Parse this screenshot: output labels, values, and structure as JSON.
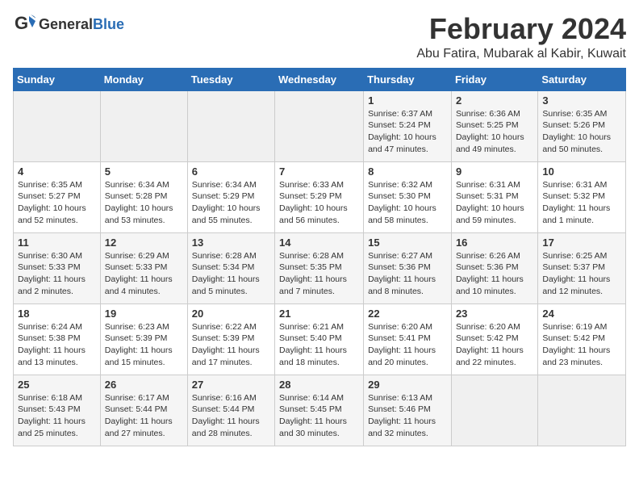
{
  "header": {
    "logo_general": "General",
    "logo_blue": "Blue",
    "month_title": "February 2024",
    "location": "Abu Fatira, Mubarak al Kabir, Kuwait"
  },
  "weekdays": [
    "Sunday",
    "Monday",
    "Tuesday",
    "Wednesday",
    "Thursday",
    "Friday",
    "Saturday"
  ],
  "weeks": [
    [
      {
        "day": "",
        "info": ""
      },
      {
        "day": "",
        "info": ""
      },
      {
        "day": "",
        "info": ""
      },
      {
        "day": "",
        "info": ""
      },
      {
        "day": "1",
        "info": "Sunrise: 6:37 AM\nSunset: 5:24 PM\nDaylight: 10 hours\nand 47 minutes."
      },
      {
        "day": "2",
        "info": "Sunrise: 6:36 AM\nSunset: 5:25 PM\nDaylight: 10 hours\nand 49 minutes."
      },
      {
        "day": "3",
        "info": "Sunrise: 6:35 AM\nSunset: 5:26 PM\nDaylight: 10 hours\nand 50 minutes."
      }
    ],
    [
      {
        "day": "4",
        "info": "Sunrise: 6:35 AM\nSunset: 5:27 PM\nDaylight: 10 hours\nand 52 minutes."
      },
      {
        "day": "5",
        "info": "Sunrise: 6:34 AM\nSunset: 5:28 PM\nDaylight: 10 hours\nand 53 minutes."
      },
      {
        "day": "6",
        "info": "Sunrise: 6:34 AM\nSunset: 5:29 PM\nDaylight: 10 hours\nand 55 minutes."
      },
      {
        "day": "7",
        "info": "Sunrise: 6:33 AM\nSunset: 5:29 PM\nDaylight: 10 hours\nand 56 minutes."
      },
      {
        "day": "8",
        "info": "Sunrise: 6:32 AM\nSunset: 5:30 PM\nDaylight: 10 hours\nand 58 minutes."
      },
      {
        "day": "9",
        "info": "Sunrise: 6:31 AM\nSunset: 5:31 PM\nDaylight: 10 hours\nand 59 minutes."
      },
      {
        "day": "10",
        "info": "Sunrise: 6:31 AM\nSunset: 5:32 PM\nDaylight: 11 hours\nand 1 minute."
      }
    ],
    [
      {
        "day": "11",
        "info": "Sunrise: 6:30 AM\nSunset: 5:33 PM\nDaylight: 11 hours\nand 2 minutes."
      },
      {
        "day": "12",
        "info": "Sunrise: 6:29 AM\nSunset: 5:33 PM\nDaylight: 11 hours\nand 4 minutes."
      },
      {
        "day": "13",
        "info": "Sunrise: 6:28 AM\nSunset: 5:34 PM\nDaylight: 11 hours\nand 5 minutes."
      },
      {
        "day": "14",
        "info": "Sunrise: 6:28 AM\nSunset: 5:35 PM\nDaylight: 11 hours\nand 7 minutes."
      },
      {
        "day": "15",
        "info": "Sunrise: 6:27 AM\nSunset: 5:36 PM\nDaylight: 11 hours\nand 8 minutes."
      },
      {
        "day": "16",
        "info": "Sunrise: 6:26 AM\nSunset: 5:36 PM\nDaylight: 11 hours\nand 10 minutes."
      },
      {
        "day": "17",
        "info": "Sunrise: 6:25 AM\nSunset: 5:37 PM\nDaylight: 11 hours\nand 12 minutes."
      }
    ],
    [
      {
        "day": "18",
        "info": "Sunrise: 6:24 AM\nSunset: 5:38 PM\nDaylight: 11 hours\nand 13 minutes."
      },
      {
        "day": "19",
        "info": "Sunrise: 6:23 AM\nSunset: 5:39 PM\nDaylight: 11 hours\nand 15 minutes."
      },
      {
        "day": "20",
        "info": "Sunrise: 6:22 AM\nSunset: 5:39 PM\nDaylight: 11 hours\nand 17 minutes."
      },
      {
        "day": "21",
        "info": "Sunrise: 6:21 AM\nSunset: 5:40 PM\nDaylight: 11 hours\nand 18 minutes."
      },
      {
        "day": "22",
        "info": "Sunrise: 6:20 AM\nSunset: 5:41 PM\nDaylight: 11 hours\nand 20 minutes."
      },
      {
        "day": "23",
        "info": "Sunrise: 6:20 AM\nSunset: 5:42 PM\nDaylight: 11 hours\nand 22 minutes."
      },
      {
        "day": "24",
        "info": "Sunrise: 6:19 AM\nSunset: 5:42 PM\nDaylight: 11 hours\nand 23 minutes."
      }
    ],
    [
      {
        "day": "25",
        "info": "Sunrise: 6:18 AM\nSunset: 5:43 PM\nDaylight: 11 hours\nand 25 minutes."
      },
      {
        "day": "26",
        "info": "Sunrise: 6:17 AM\nSunset: 5:44 PM\nDaylight: 11 hours\nand 27 minutes."
      },
      {
        "day": "27",
        "info": "Sunrise: 6:16 AM\nSunset: 5:44 PM\nDaylight: 11 hours\nand 28 minutes."
      },
      {
        "day": "28",
        "info": "Sunrise: 6:14 AM\nSunset: 5:45 PM\nDaylight: 11 hours\nand 30 minutes."
      },
      {
        "day": "29",
        "info": "Sunrise: 6:13 AM\nSunset: 5:46 PM\nDaylight: 11 hours\nand 32 minutes."
      },
      {
        "day": "",
        "info": ""
      },
      {
        "day": "",
        "info": ""
      }
    ]
  ]
}
